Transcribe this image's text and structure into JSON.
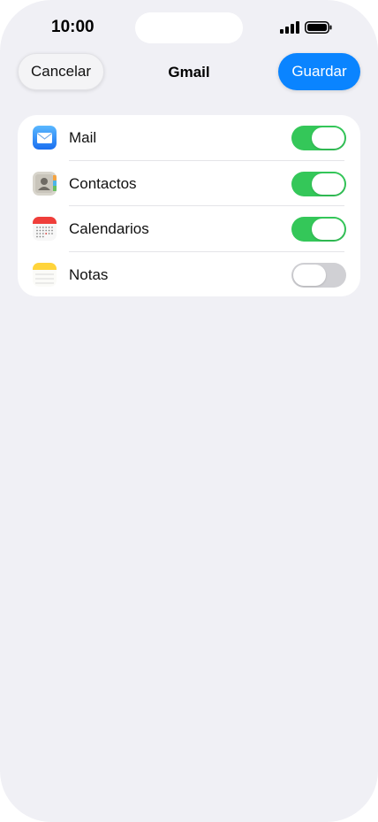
{
  "status_bar": {
    "time": "10:00",
    "signal_icon": "cellular-signal-icon",
    "battery_icon": "battery-full-icon"
  },
  "nav": {
    "cancel_label": "Cancelar",
    "title": "Gmail",
    "save_label": "Guardar"
  },
  "sync_items": [
    {
      "label": "Mail",
      "icon": "mail-app-icon",
      "enabled": true
    },
    {
      "label": "Contactos",
      "icon": "contacts-app-icon",
      "enabled": true
    },
    {
      "label": "Calendarios",
      "icon": "calendar-app-icon",
      "enabled": true
    },
    {
      "label": "Notas",
      "icon": "notes-app-icon",
      "enabled": false
    }
  ],
  "colors": {
    "accent_blue": "#0a84ff",
    "toggle_on": "#34c759",
    "toggle_off": "#d0d0d4",
    "background": "#f0f0f5"
  }
}
